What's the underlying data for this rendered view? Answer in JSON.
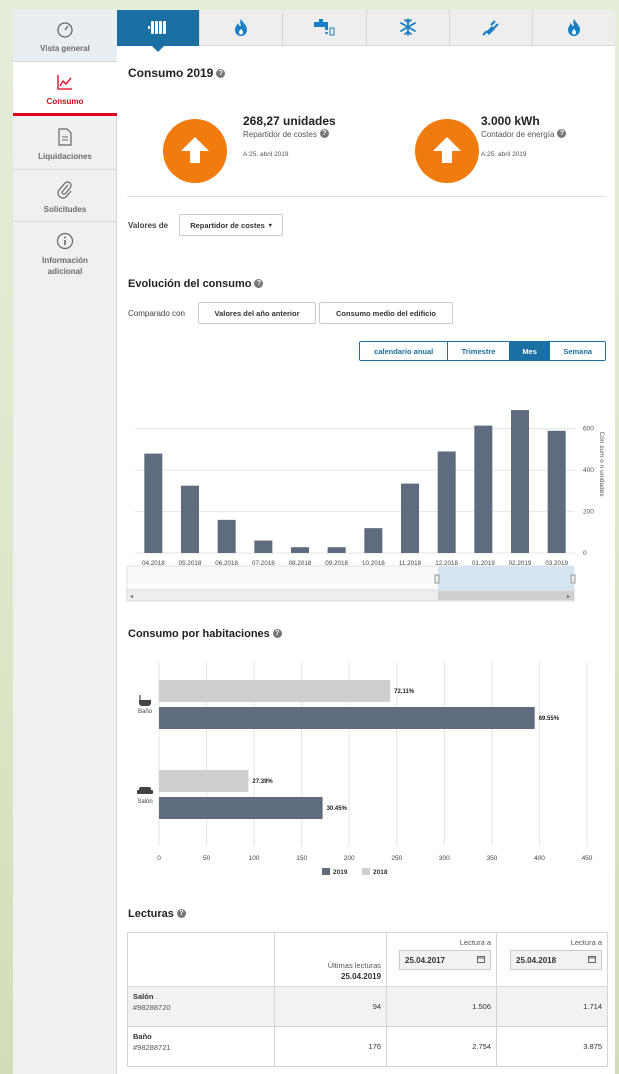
{
  "sidebar": {
    "items": [
      {
        "label": "Vista general",
        "icon": "gauge-icon"
      },
      {
        "label": "Consumo",
        "icon": "line-chart-icon"
      },
      {
        "label": "Liquidaciones",
        "icon": "document-icon"
      },
      {
        "label": "Solicitudes",
        "icon": "paperclip-icon"
      },
      {
        "label": "Información adicional",
        "icon": "info-icon"
      }
    ]
  },
  "tabs": [
    "radiator-icon",
    "flame-icon",
    "water-tap-icon",
    "snowflake-icon",
    "plug-icon",
    "flame-icon"
  ],
  "summary": {
    "title": "Consumo 2019",
    "help": "?",
    "kpis": [
      {
        "value": "268,27 unidades",
        "label": "Repartidor de costes",
        "date": "A:25. abril 2019"
      },
      {
        "value": "3.000 kWh",
        "label": "Contador de energía",
        "date": "A:25. abril 2019"
      }
    ]
  },
  "values_of": {
    "label": "Valores de",
    "selected": "Repartidor de costes"
  },
  "evolution": {
    "title": "Evolución del consumo",
    "compare_label": "Comparado con",
    "compare_buttons": [
      "Valores del año anterior",
      "Consumo medio del edificio"
    ],
    "periods": [
      "calendario anual",
      "Trimestre",
      "Mes",
      "Semana"
    ],
    "active_period": "Mes"
  },
  "rooms": {
    "title": "Consumo por habitaciones",
    "legend": [
      "2019",
      "2018"
    ]
  },
  "readings": {
    "title": "Lecturas",
    "last_label": "Últimas lecturas",
    "last_date": "25.04.2019",
    "reading_at": "Lectura a",
    "date1": "25.04.2017",
    "date2": "25.04.2018",
    "rows": [
      {
        "room": "Salón",
        "id": "#98288720",
        "last": "94",
        "v1": "1.506",
        "v2": "1.714"
      },
      {
        "room": "Baño",
        "id": "#98288721",
        "last": "176",
        "v1": "2.754",
        "v2": "3.875"
      }
    ]
  },
  "chart_data": [
    {
      "type": "bar",
      "title": "",
      "categories": [
        "04.2018",
        "05.2018",
        "06.2018",
        "07.2018",
        "08.2018",
        "09.2018",
        "10.2018",
        "11.2018",
        "12.2018",
        "01.2019",
        "02.2019",
        "03.2019"
      ],
      "values": [
        480,
        325,
        160,
        60,
        28,
        28,
        120,
        335,
        490,
        615,
        690,
        590
      ],
      "ylabel": "Con sum o n unidades",
      "ylim": [
        0,
        700
      ],
      "yticks": [
        "0",
        "200",
        "400",
        "600"
      ],
      "color": "#5f6b7e"
    },
    {
      "type": "bar",
      "orientation": "horizontal",
      "categories": [
        "Baño",
        "Salón"
      ],
      "series": [
        {
          "name": "2019",
          "values": [
            395,
            172
          ],
          "labels": [
            "69.55%",
            "30.45%"
          ],
          "color": "#5f6b7e"
        },
        {
          "name": "2018",
          "values": [
            243,
            94
          ],
          "labels": [
            "72.11%",
            "27.39%"
          ],
          "color": "#cfcfcf"
        }
      ],
      "xlim": [
        0,
        450
      ],
      "xticks": [
        "0",
        "50",
        "100",
        "150",
        "200",
        "250",
        "300",
        "350",
        "400",
        "450"
      ]
    }
  ]
}
